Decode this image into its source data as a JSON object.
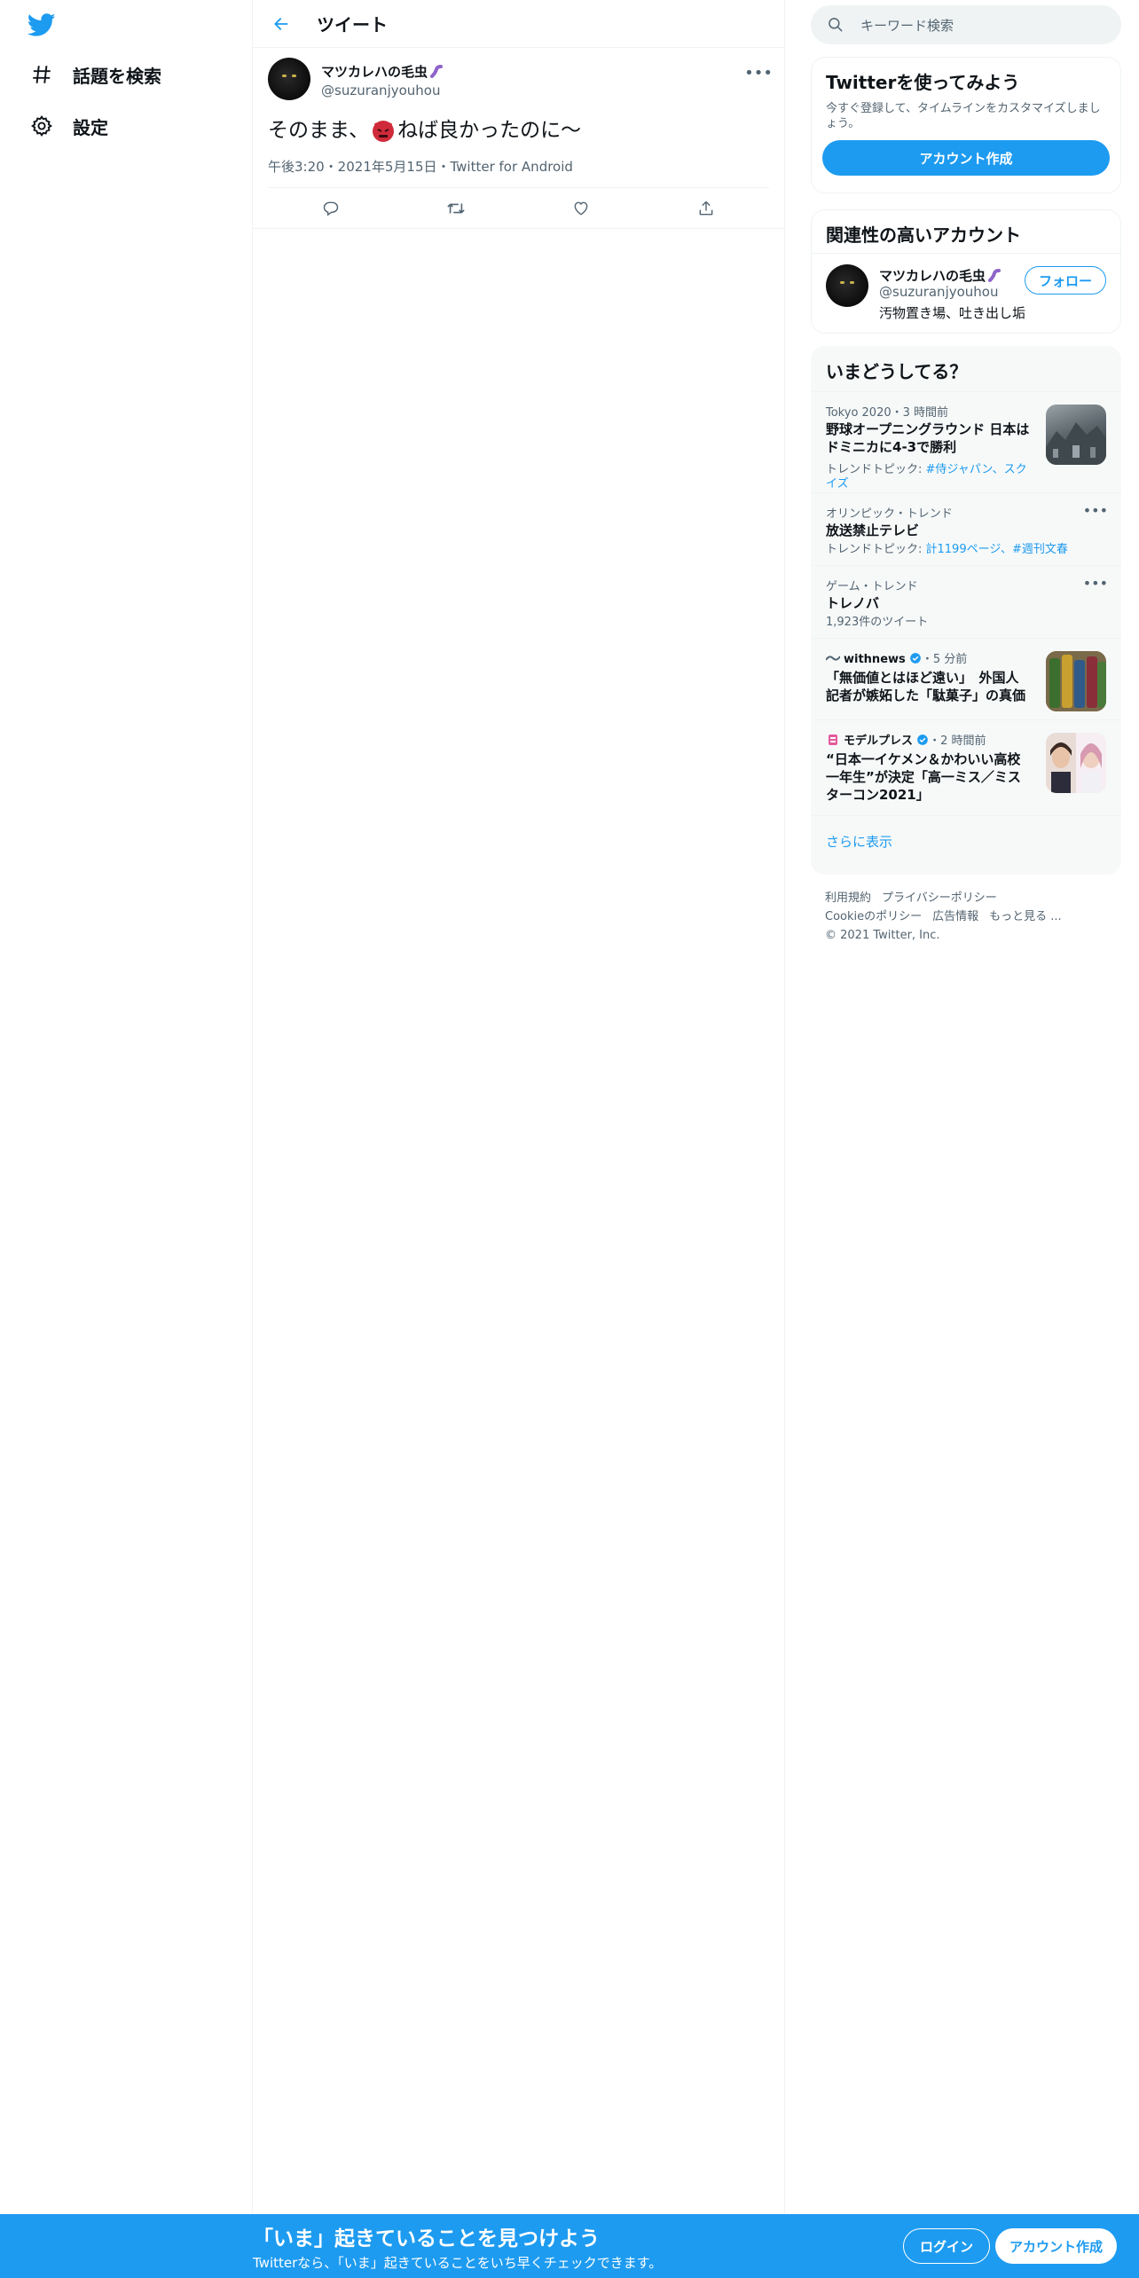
{
  "nav": {
    "explore_label": "話題を検索",
    "settings_label": "設定"
  },
  "header": {
    "title": "ツイート"
  },
  "tweet": {
    "name": "マツカレハの毛虫",
    "handle": "@suzuranjyouhou",
    "text_before": "そのまま、",
    "text_after": "ねば良かったのに〜",
    "meta": "午後3:20・2021年5月15日・Twitter for Android"
  },
  "search": {
    "placeholder": "キーワード検索"
  },
  "signup_card": {
    "title": "Twitterを使ってみよう",
    "subtitle": "今すぐ登録して、タイムラインをカスタマイズしましょう。",
    "button": "アカウント作成"
  },
  "related": {
    "title": "関連性の高いアカウント",
    "name": "マツカレハの毛虫",
    "handle": "@suzuranjyouhou",
    "bio": "汚物置き場、吐き出し垢",
    "follow": "フォロー"
  },
  "trends": {
    "title": "いまどうしてる？",
    "items": [
      {
        "category": "Tokyo 2020・3 時間前",
        "title": "野球オープニングラウンド 日本はドミニカに4-3で勝利",
        "sub_prefix": "トレンドトピック: ",
        "sub_link": "#侍ジャパン、スクイズ"
      },
      {
        "category": "オリンピック・トレンド",
        "title": "放送禁止テレビ",
        "sub_prefix": "トレンドトピック: ",
        "sub_link": "計1199ページ、#週刊文春"
      },
      {
        "category": "ゲーム・トレンド",
        "title": "トレノバ",
        "sub": "1,923件のツイート"
      },
      {
        "source": "withnews",
        "time": "・5 分前",
        "title": "「無価値とはほど遠い」　外国人記者が嫉妬した「駄菓子」の真価"
      },
      {
        "source": "モデルプレス",
        "time": "・2 時間前",
        "title": "“日本一イケメン＆かわいい高校一年生”が決定「高一ミス／ミスターコン2021」"
      }
    ],
    "show_more": "さらに表示"
  },
  "footer": {
    "terms": "利用規約",
    "privacy": "プライバシーポリシー",
    "cookie": "Cookieのポリシー",
    "ads": "広告情報",
    "more": "もっと見る ...",
    "copyright": "© 2021 Twitter, Inc."
  },
  "bottom_bar": {
    "title": "「いま」起きていることを見つけよう",
    "subtitle": "Twitterなら、「いま」起きていることをいち早くチェックできます。",
    "login": "ログイン",
    "signup": "アカウント作成"
  },
  "colors": {
    "accent": "#1d9bf0",
    "text_primary": "#0f1419",
    "text_secondary": "#536471",
    "border": "#eff3f4",
    "panel_bg": "#f7f9f9"
  },
  "icons": {
    "logo": "twitter-bird-icon",
    "explore": "hashtag-icon",
    "settings": "gear-icon",
    "back": "arrow-left-icon",
    "more": "ellipsis-icon",
    "reply": "reply-icon",
    "retweet": "retweet-icon",
    "like": "heart-icon",
    "share": "share-icon",
    "search": "search-icon",
    "verified": "verified-badge-icon"
  }
}
